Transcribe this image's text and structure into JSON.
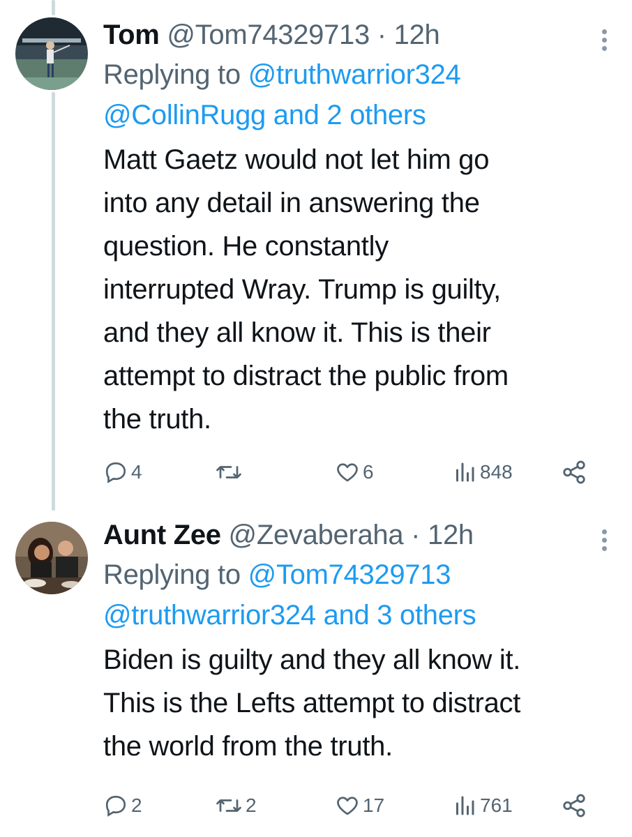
{
  "tweets": [
    {
      "name": "Tom",
      "handle": "@Tom74329713",
      "separator": "·",
      "time": "12h",
      "replying_prefix": "Replying to",
      "replying_line1": "@truthwarrior324",
      "replying_line2": "@CollinRugg and 2 others",
      "body": [
        "Matt Gaetz would not let him go",
        "into any detail in answering the",
        "question. He constantly",
        "interrupted Wray. Trump is guilty,",
        "and they all know it. This is their",
        "attempt to distract the public from",
        "the truth."
      ],
      "replies": "4",
      "retweets": "",
      "likes": "6",
      "views": "848"
    },
    {
      "name": "Aunt Zee",
      "handle": "@Zevaberaha",
      "separator": "·",
      "time": "12h",
      "replying_prefix": "Replying to",
      "replying_line1": "@Tom74329713",
      "replying_line2": "@truthwarrior324 and 3 others",
      "body": [
        "Biden is guilty and they all know it.",
        "This is the Lefts attempt to distract",
        "the world from the truth."
      ],
      "replies": "2",
      "retweets": "2",
      "likes": "17",
      "views": "761"
    }
  ],
  "colors": {
    "text": "#0f1419",
    "muted": "#536471",
    "link": "#1d9bf0",
    "thread_line": "#cfd9de"
  },
  "icons": [
    "reply-icon",
    "retweet-icon",
    "like-icon",
    "views-icon",
    "share-icon",
    "more-icon"
  ]
}
